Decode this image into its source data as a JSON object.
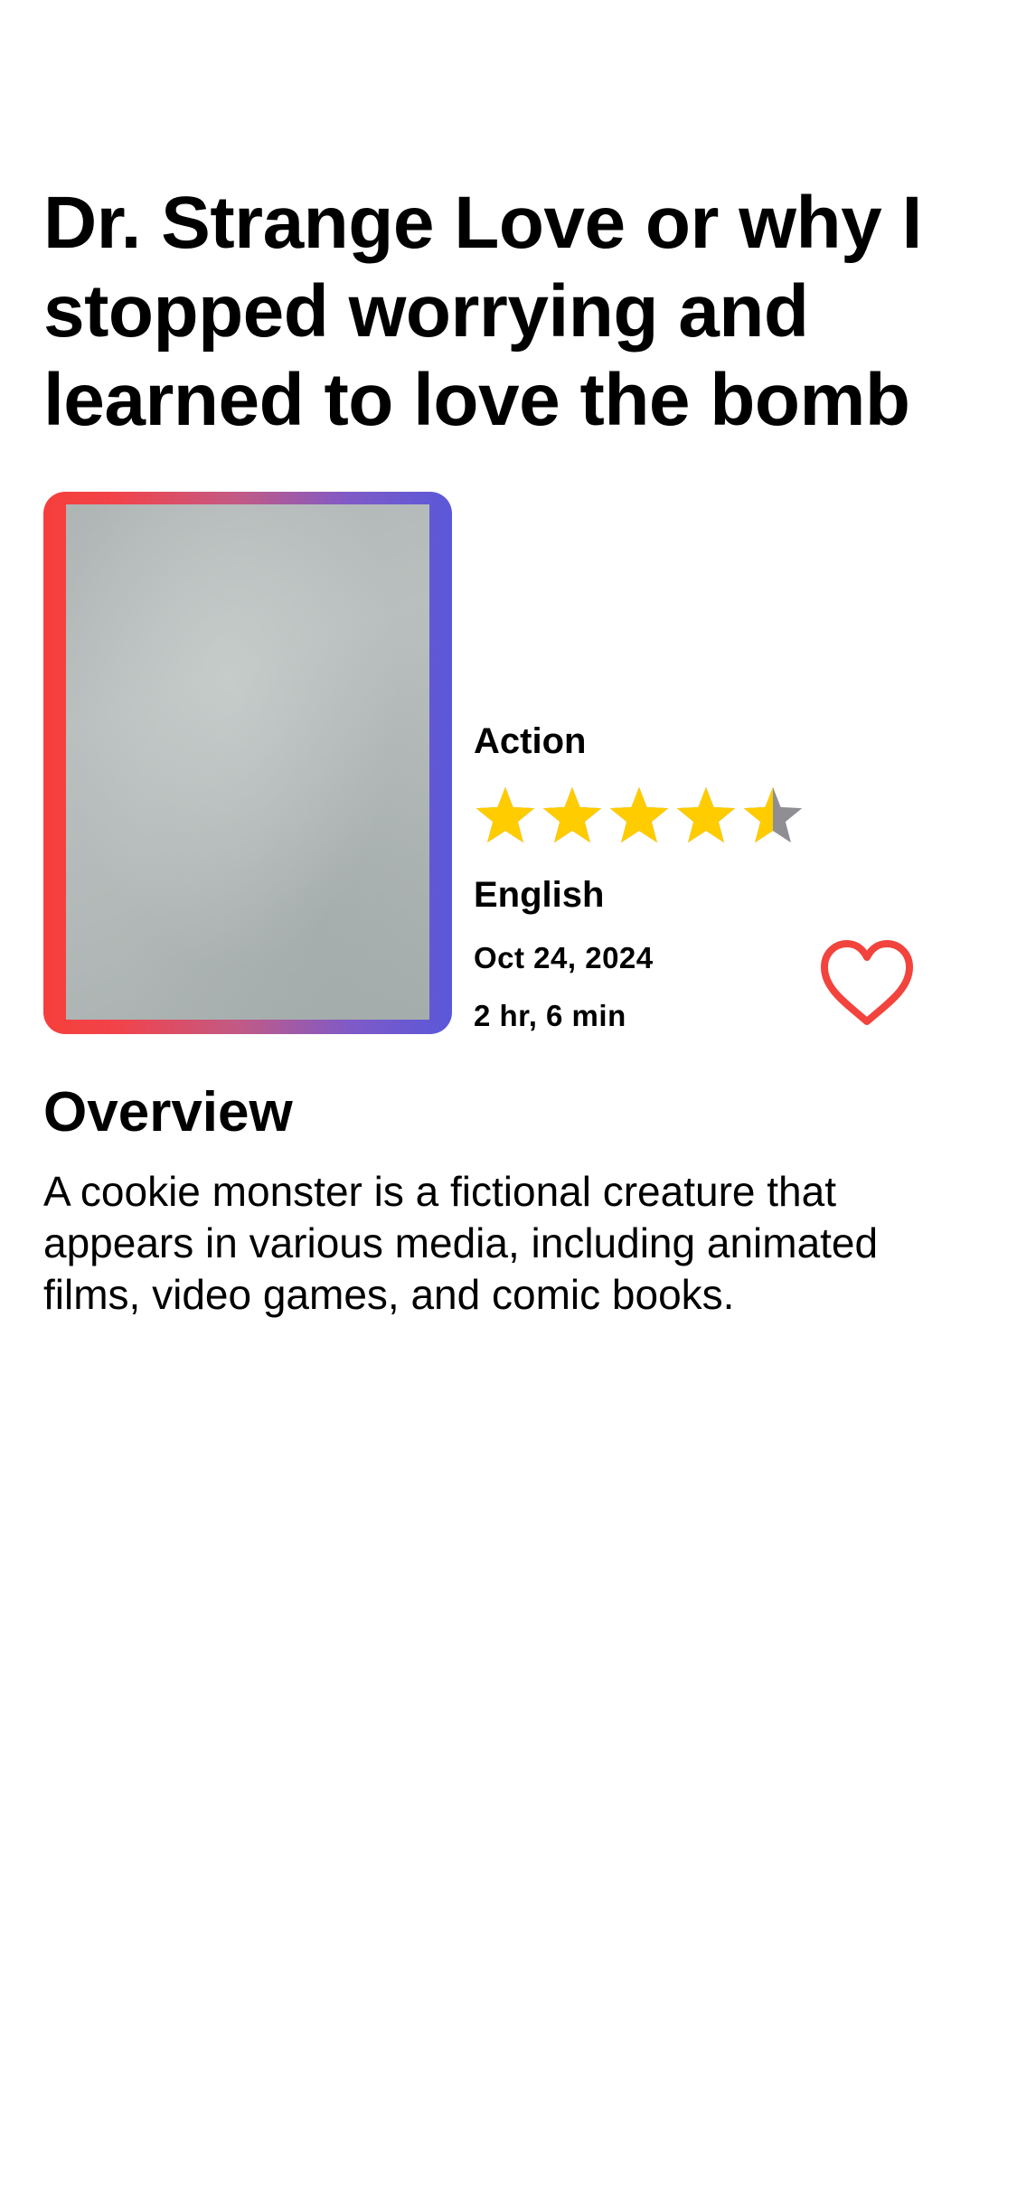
{
  "movie": {
    "title": "Dr. Strange Love or why I stopped worrying and learned to love the bomb",
    "genre": "Action",
    "rating": 4.5,
    "rating_max": 5,
    "language": "English",
    "release_date": "Oct 24, 2024",
    "runtime": "2 hr, 6 min",
    "favorited": false
  },
  "overview": {
    "heading": "Overview",
    "text": "A cookie monster is a fictional creature that appears in various media, including animated films, video games, and comic books."
  },
  "icons": {
    "rating": "star-icon",
    "favorite": "heart-outline-icon"
  },
  "colors": {
    "star_filled": "#ffcc00",
    "star_empty": "#8e8e93",
    "heart": "#f2433d",
    "poster_gradient_start": "#f63f3b",
    "poster_gradient_end": "#5a58d9"
  }
}
